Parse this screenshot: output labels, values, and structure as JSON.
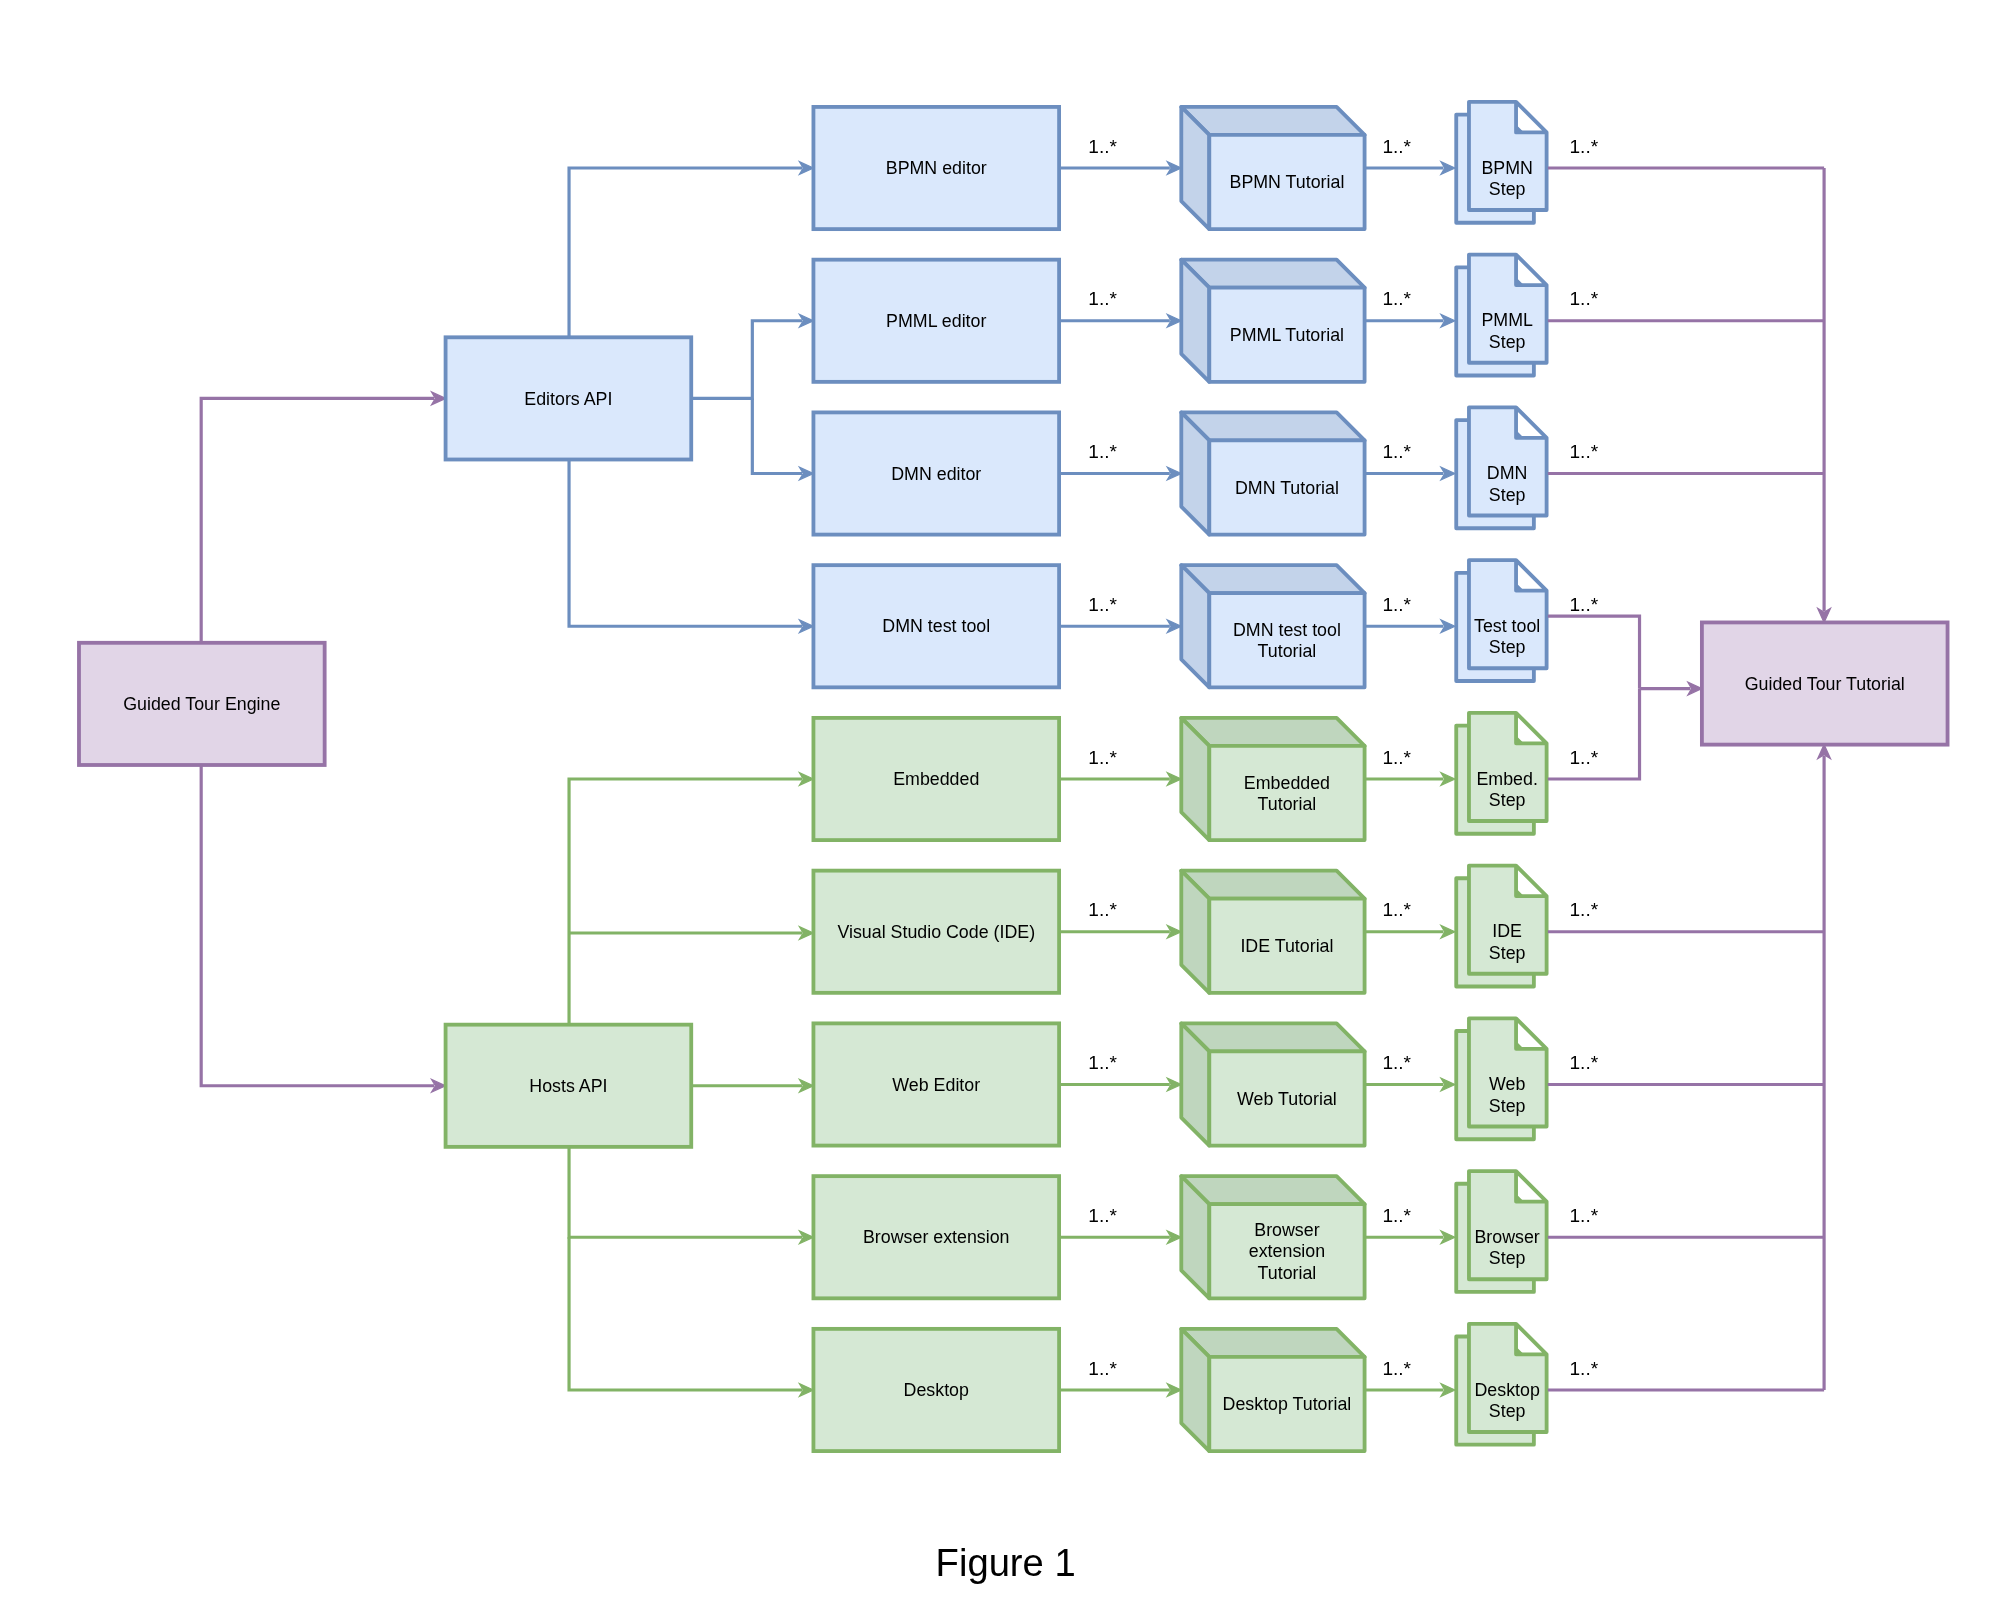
{
  "engine": {
    "label": "Guided Tour Engine"
  },
  "apis": [
    {
      "kind": "editors",
      "label": "Editors  API"
    },
    {
      "kind": "hosts",
      "label": "Hosts API"
    }
  ],
  "rows": [
    {
      "kind": "editors",
      "component": "BPMN editor",
      "tutorial": [
        "BPMN Tutorial"
      ],
      "step": [
        "BPMN",
        "Step"
      ],
      "multiplicities": [
        "1..*",
        "1..*",
        "1..*"
      ]
    },
    {
      "kind": "editors",
      "component": "PMML editor",
      "tutorial": [
        "PMML Tutorial"
      ],
      "step": [
        "PMML",
        "Step"
      ],
      "multiplicities": [
        "1..*",
        "1..*",
        "1..*"
      ]
    },
    {
      "kind": "editors",
      "component": "DMN editor",
      "tutorial": [
        "DMN Tutorial"
      ],
      "step": [
        "DMN",
        "Step"
      ],
      "multiplicities": [
        "1..*",
        "1..*",
        "1..*"
      ]
    },
    {
      "kind": "editors",
      "component": "DMN test tool",
      "tutorial": [
        "DMN test tool",
        "Tutorial"
      ],
      "step": [
        "Test tool",
        "Step"
      ],
      "multiplicities": [
        "1..*",
        "1..*",
        "1..*"
      ]
    },
    {
      "kind": "hosts",
      "component": "Embedded",
      "tutorial": [
        "Embedded",
        "Tutorial"
      ],
      "step": [
        "Embed.",
        "Step"
      ],
      "multiplicities": [
        "1..*",
        "1..*",
        "1..*"
      ]
    },
    {
      "kind": "hosts",
      "component": "Visual Studio Code (IDE)",
      "tutorial": [
        "IDE Tutorial"
      ],
      "step": [
        "IDE",
        "Step"
      ],
      "multiplicities": [
        "1..*",
        "1..*",
        "1..*"
      ]
    },
    {
      "kind": "hosts",
      "component": "Web Editor",
      "tutorial": [
        "Web Tutorial"
      ],
      "step": [
        "Web",
        "Step"
      ],
      "multiplicities": [
        "1..*",
        "1..*",
        "1..*"
      ]
    },
    {
      "kind": "hosts",
      "component": "Browser extension",
      "tutorial": [
        "Browser",
        "extension",
        "Tutorial"
      ],
      "step": [
        "Browser",
        "Step"
      ],
      "multiplicities": [
        "1..*",
        "1..*",
        "1..*"
      ]
    },
    {
      "kind": "hosts",
      "component": "Desktop",
      "tutorial": [
        "Desktop Tutorial"
      ],
      "step": [
        "Desktop",
        "Step"
      ],
      "multiplicities": [
        "1..*",
        "1..*",
        "1..*"
      ]
    }
  ],
  "target": {
    "label": "Guided Tour Tutorial"
  },
  "caption": "Figure 1"
}
